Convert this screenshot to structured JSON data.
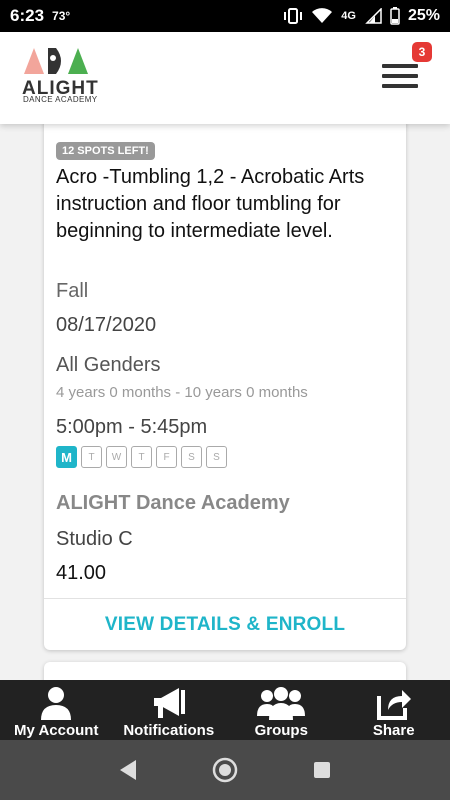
{
  "status_bar": {
    "time": "6:23",
    "temperature": "73°",
    "network": "4G",
    "battery": "25%"
  },
  "header": {
    "logo_name": "ALIGHT",
    "logo_sub": "DANCE ACADEMY",
    "notification_count": "3"
  },
  "class_card": {
    "spots_left": "12 SPOTS LEFT!",
    "title": "Acro -Tumbling 1,2 - Acrobatic Arts instruction and floor tumbling for beginning to intermediate level.",
    "season": "Fall",
    "start_date": "08/17/2020",
    "gender": "All Genders",
    "age_range": "4 years 0 months - 10 years 0 months",
    "time_range": "5:00pm - 5:45pm",
    "days": [
      {
        "label": "M",
        "active": true
      },
      {
        "label": "T",
        "active": false
      },
      {
        "label": "W",
        "active": false
      },
      {
        "label": "T",
        "active": false
      },
      {
        "label": "F",
        "active": false
      },
      {
        "label": "S",
        "active": false
      },
      {
        "label": "S",
        "active": false
      }
    ],
    "academy": "ALIGHT Dance Academy",
    "studio": "Studio C",
    "price": "41.00",
    "enroll_label": "VIEW DETAILS & ENROLL"
  },
  "bottom_nav": {
    "items": [
      {
        "label": "My Account",
        "icon": "person-icon"
      },
      {
        "label": "Notifications",
        "icon": "megaphone-icon"
      },
      {
        "label": "Groups",
        "icon": "groups-icon"
      },
      {
        "label": "Share",
        "icon": "share-icon"
      }
    ]
  },
  "colors": {
    "accent": "#1fb5c9",
    "badge": "#e53935",
    "nav_bg": "#222222"
  }
}
